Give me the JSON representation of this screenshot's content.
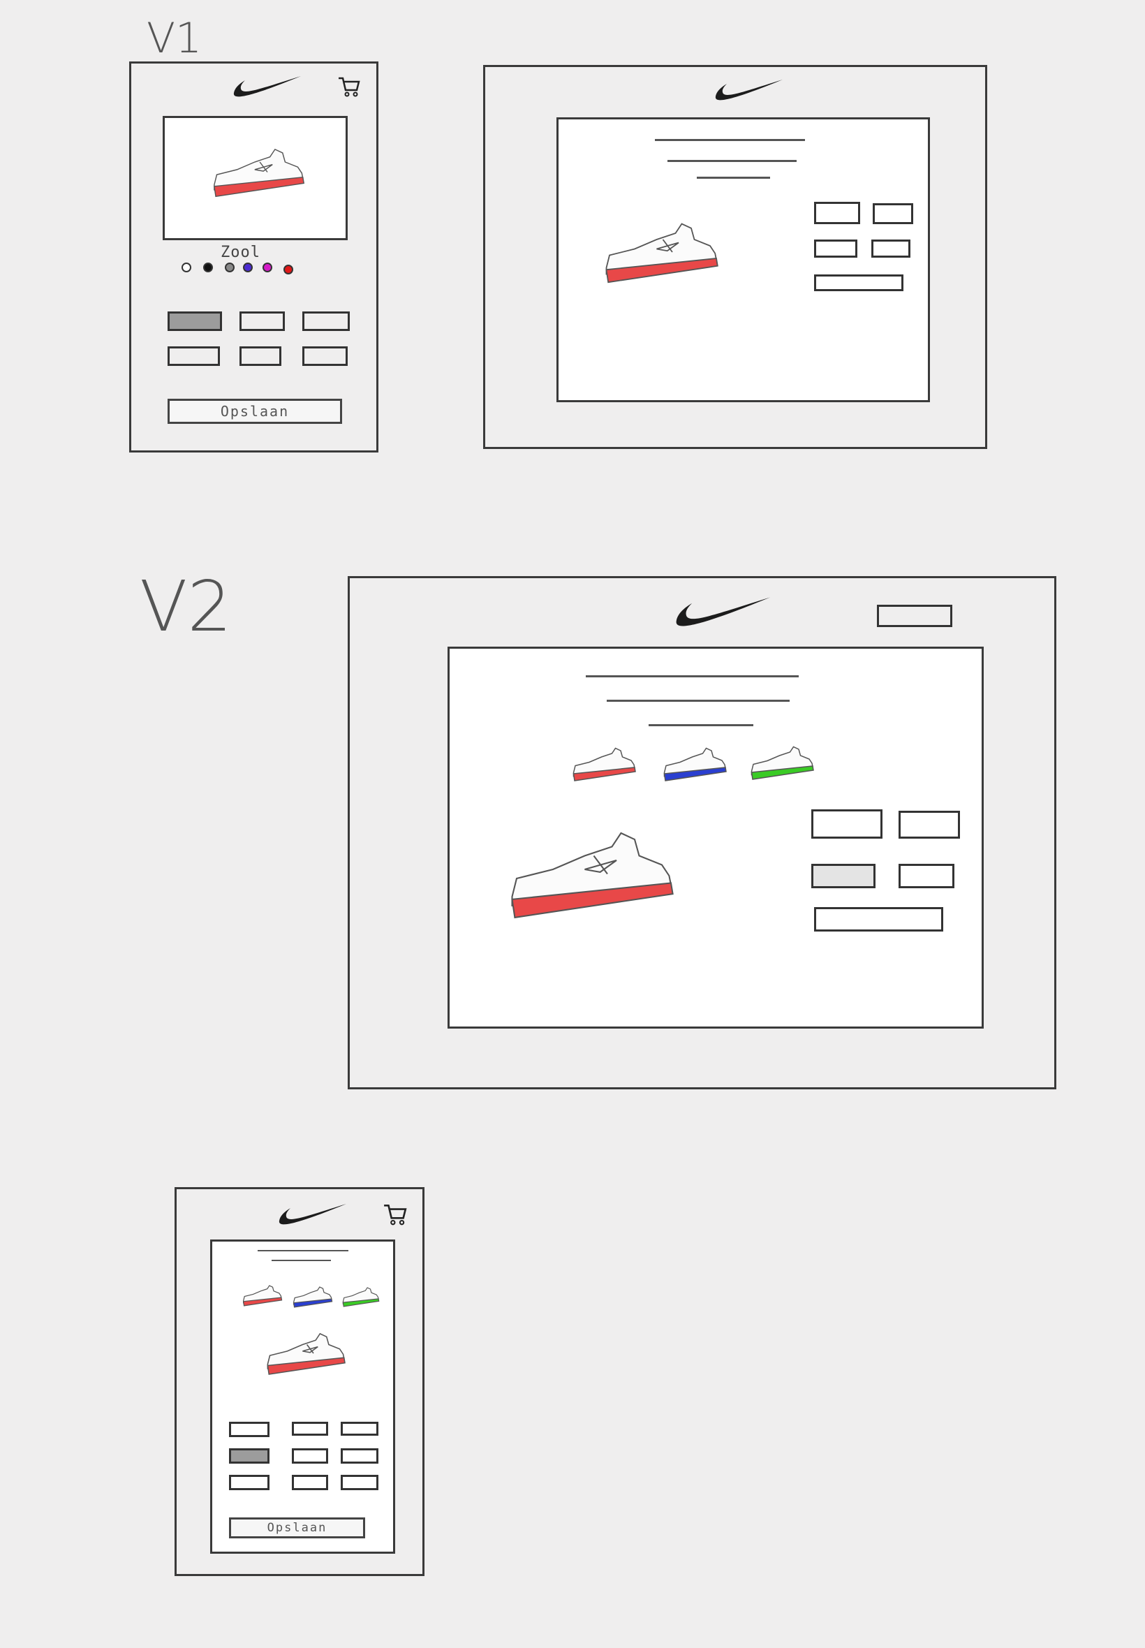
{
  "v1": {
    "label": "V1",
    "mobile": {
      "color_label": "Zool",
      "colors": [
        "#ffffff",
        "#111111",
        "#888888",
        "#4b2bd1",
        "#d41bc8",
        "#e01818"
      ],
      "sole_color": "#e84848",
      "save_label": "Opslaan"
    },
    "desktop": {
      "sole_color": "#e84848"
    }
  },
  "v2": {
    "label": "V2",
    "desktop": {
      "variant_soles": [
        "#e84848",
        "#2a3fd0",
        "#3acb25"
      ],
      "sole_color": "#e84848"
    },
    "mobile": {
      "variant_soles": [
        "#e84848",
        "#2a3fd0",
        "#3acb25"
      ],
      "sole_color": "#e84848",
      "save_label": "Opslaan"
    }
  },
  "icons": {
    "logo": "nike-swoosh-icon",
    "cart": "cart-icon"
  }
}
